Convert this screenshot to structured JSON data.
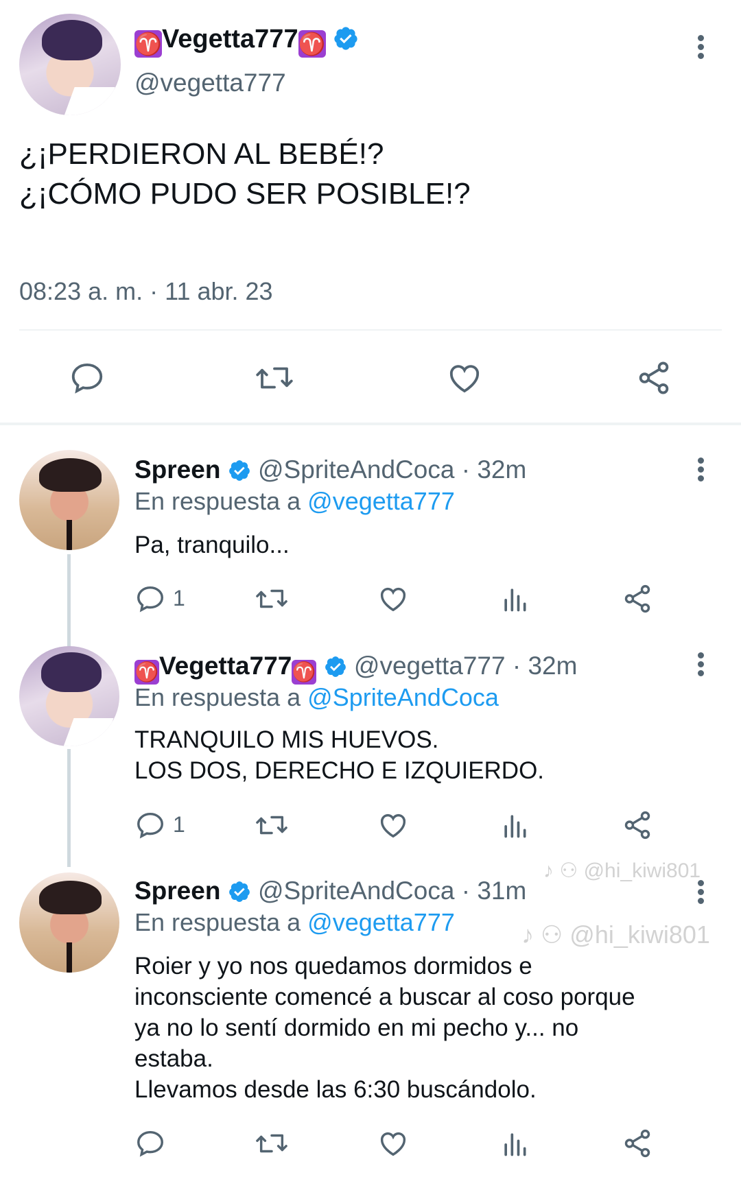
{
  "main": {
    "display_name": "Vegetta777",
    "zodiac_icon": "aries-icon",
    "handle": "@vegetta777",
    "text_line1": "¿¡PERDIERON AL BEBÉ!?",
    "text_line2": "¿¡CÓMO PUDO SER POSIBLE!?",
    "timestamp": "08:23 a. m. · 11 abr. 23"
  },
  "replies": [
    {
      "display_name": "Spreen",
      "handle": "@SpriteAndCoca",
      "time": "· 32m",
      "reply_prefix": "En respuesta a",
      "reply_to": "@vegetta777",
      "text": [
        "Pa, tranquilo..."
      ],
      "reply_count": "1"
    },
    {
      "display_name": "Vegetta777",
      "handle": "@vegetta777",
      "time": "· 32m",
      "reply_prefix": "En respuesta a",
      "reply_to": "@SpriteAndCoca",
      "text": [
        "TRANQUILO MIS HUEVOS.",
        "LOS DOS, DERECHO E IZQUIERDO."
      ],
      "reply_count": "1"
    },
    {
      "display_name": "Spreen",
      "handle": "@SpriteAndCoca",
      "time": "· 31m",
      "reply_prefix": "En respuesta a",
      "reply_to": "@vegetta777",
      "text": [
        "Roier y yo nos quedamos dormidos e",
        "inconsciente comencé a buscar al coso porque",
        "ya no lo sentí dormido en mi pecho y... no",
        "estaba.",
        "Llevamos desde las 6:30 buscándolo."
      ],
      "reply_count": ""
    }
  ],
  "watermarks": [
    "@hi_kiwi801",
    "@hi_kiwi801"
  ],
  "colors": {
    "verified": "#1d9bf0",
    "aries": "#9b3fd1",
    "link": "#1d9bf0",
    "muted": "#536471"
  }
}
